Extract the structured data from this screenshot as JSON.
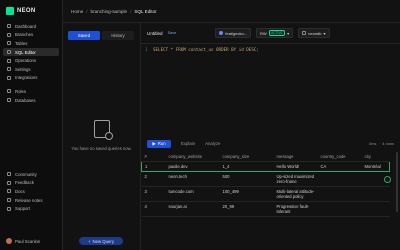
{
  "app": {
    "logo_text": "NEON",
    "brand_color": "#00e599"
  },
  "sidebar": {
    "items": [
      {
        "label": "Dashboard",
        "icon": "grid-icon"
      },
      {
        "label": "Branches",
        "icon": "branch-icon"
      },
      {
        "label": "Tables",
        "icon": "table-icon"
      },
      {
        "label": "SQL Editor",
        "icon": "terminal-icon",
        "active": true
      },
      {
        "label": "Operations",
        "icon": "list-icon"
      },
      {
        "label": "Settings",
        "icon": "gear-icon"
      },
      {
        "label": "Integrations",
        "icon": "puzzle-icon"
      },
      {
        "label": "Roles",
        "icon": "user-icon"
      },
      {
        "label": "Databases",
        "icon": "database-icon"
      }
    ],
    "footer_items": [
      {
        "label": "Community",
        "icon": "chat-icon"
      },
      {
        "label": "Feedback",
        "icon": "message-icon"
      },
      {
        "label": "Docs",
        "icon": "book-icon"
      },
      {
        "label": "Release notes",
        "icon": "note-icon"
      },
      {
        "label": "Support",
        "icon": "help-icon"
      }
    ],
    "user_name": "Paul Scanlon"
  },
  "breadcrumb": {
    "home": "Home",
    "branch": "branching-sample",
    "page": "SQL Editor"
  },
  "left_panel": {
    "tab_saved": "Saved",
    "tab_history": "History",
    "empty_text": "You have no saved queries now.",
    "new_query": "New Query"
  },
  "editor": {
    "title": "Untitled",
    "save_label": "Save",
    "branch": "feat/gecko...",
    "compute": "RW",
    "status": "ACTIVE",
    "database": "neondb",
    "line_number": "1",
    "query_select": "SELECT * FROM contact_us ORDER BY id DESC;"
  },
  "results": {
    "run_label": "Run",
    "explain_label": "Explain",
    "analyze_label": "Analyze",
    "timing": "0ms",
    "rows": "4 rows",
    "columns": [
      "#",
      "company_website",
      "company_size",
      "message",
      "country_code",
      "city"
    ],
    "rows_data": [
      [
        "1",
        "paulie.dev",
        "1_4",
        "Hello World!",
        "CA",
        "Montréal"
      ],
      [
        "2",
        "neon.tech",
        "500",
        "Up-sized maximized zero-frame",
        "",
        ""
      ],
      [
        "3",
        "tumcode.com",
        "100_499",
        "Multi-lateral attitude-oriented policy",
        "",
        ""
      ],
      [
        "4",
        "sourjan.ai",
        "20_99",
        "Progressive fault-tolerant",
        "",
        ""
      ]
    ]
  }
}
